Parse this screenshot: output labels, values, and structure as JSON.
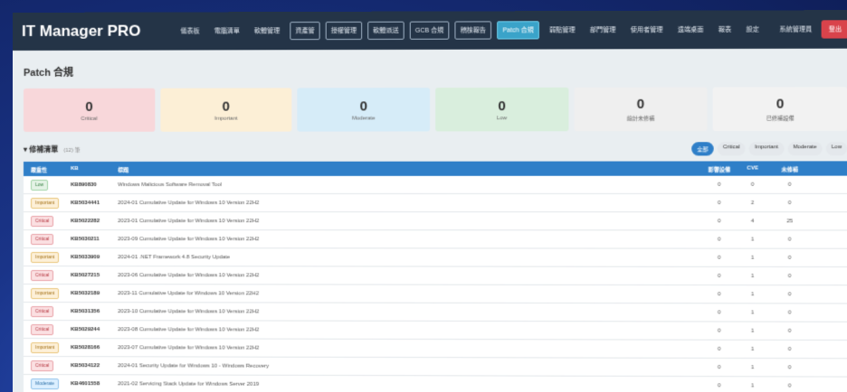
{
  "app": {
    "title": "IT Manager PRO",
    "user": "系統管理員",
    "logout": "登出"
  },
  "nav": [
    {
      "label": "儀表板",
      "style": "plain"
    },
    {
      "label": "電腦清單",
      "style": "plain"
    },
    {
      "label": "軟體管理",
      "style": "plain"
    },
    {
      "label": "資產管",
      "style": "boxed"
    },
    {
      "label": "授權管理",
      "style": "boxed"
    },
    {
      "label": "軟體派送",
      "style": "boxed"
    },
    {
      "label": "GCB 合規",
      "style": "boxed"
    },
    {
      "label": "稽核報告",
      "style": "boxed"
    },
    {
      "label": "Patch 合規",
      "style": "active"
    },
    {
      "label": "弱點管理",
      "style": "plain"
    },
    {
      "label": "部門管理",
      "style": "plain"
    },
    {
      "label": "使用者管理",
      "style": "plain"
    },
    {
      "label": "遠端桌面",
      "style": "plain"
    },
    {
      "label": "報表",
      "style": "plain"
    },
    {
      "label": "設定",
      "style": "plain"
    }
  ],
  "page": {
    "title": "Patch 合規"
  },
  "stats": [
    {
      "value": "0",
      "label": "Critical",
      "tone": "critical"
    },
    {
      "value": "0",
      "label": "Important",
      "tone": "important"
    },
    {
      "value": "0",
      "label": "Moderate",
      "tone": "moderate"
    },
    {
      "value": "0",
      "label": "Low",
      "tone": "low"
    },
    {
      "value": "0",
      "label": "總計未修補",
      "tone": "gray1"
    },
    {
      "value": "0",
      "label": "已修補設備",
      "tone": "gray2"
    }
  ],
  "list": {
    "title": "▾ 修補清單",
    "count": "(12) 筆",
    "filters": [
      {
        "label": "全部",
        "active": true
      },
      {
        "label": "Critical",
        "active": false
      },
      {
        "label": "Important",
        "active": false
      },
      {
        "label": "Moderate",
        "active": false
      },
      {
        "label": "Low",
        "active": false
      }
    ],
    "columns": [
      "嚴重性",
      "KB",
      "標題",
      "影響設備",
      "CVE",
      "未修補"
    ],
    "rows": [
      {
        "sev": "Low",
        "tone": "low",
        "kb": "KB890830",
        "title": "Windows Malicious Software Removal Tool",
        "a": "0",
        "b": "0",
        "c": "0"
      },
      {
        "sev": "Important",
        "tone": "important",
        "kb": "KB5034441",
        "title": "2024-01 Cumulative Update for Windows 10 Version 22H2",
        "a": "0",
        "b": "2",
        "c": "0"
      },
      {
        "sev": "Critical",
        "tone": "critical",
        "kb": "KB5022282",
        "title": "2023-01 Cumulative Update for Windows 10 Version 22H2",
        "a": "0",
        "b": "4",
        "c": "25"
      },
      {
        "sev": "Critical",
        "tone": "critical",
        "kb": "KB5030211",
        "title": "2023-09 Cumulative Update for Windows 10 Version 22H2",
        "a": "0",
        "b": "1",
        "c": "0"
      },
      {
        "sev": "Important",
        "tone": "important",
        "kb": "KB5033909",
        "title": "2024-01 .NET Framework 4.8 Security Update",
        "a": "0",
        "b": "1",
        "c": "0"
      },
      {
        "sev": "Critical",
        "tone": "critical",
        "kb": "KB5027215",
        "title": "2023-06 Cumulative Update for Windows 10 Version 22H2",
        "a": "0",
        "b": "1",
        "c": "0"
      },
      {
        "sev": "Important",
        "tone": "important",
        "kb": "KB5032189",
        "title": "2023-11 Cumulative Update for Windows 10 Version 22H2",
        "a": "0",
        "b": "1",
        "c": "0"
      },
      {
        "sev": "Critical",
        "tone": "critical",
        "kb": "KB5031356",
        "title": "2023-10 Cumulative Update for Windows 10 Version 22H2",
        "a": "0",
        "b": "1",
        "c": "0"
      },
      {
        "sev": "Critical",
        "tone": "critical",
        "kb": "KB5029244",
        "title": "2023-08 Cumulative Update for Windows 10 Version 22H2",
        "a": "0",
        "b": "1",
        "c": "0"
      },
      {
        "sev": "Important",
        "tone": "important",
        "kb": "KB5028166",
        "title": "2023-07 Cumulative Update for Windows 10 Version 22H2",
        "a": "0",
        "b": "1",
        "c": "0"
      },
      {
        "sev": "Critical",
        "tone": "critical",
        "kb": "KB5034122",
        "title": "2024-01 Security Update for Windows 10 - Windows Recovery",
        "a": "0",
        "b": "1",
        "c": "0"
      },
      {
        "sev": "Moderate",
        "tone": "moderate",
        "kb": "KB4601558",
        "title": "2021-02 Servicing Stack Update for Windows Server 2019",
        "a": "0",
        "b": "1",
        "c": "0"
      }
    ]
  },
  "colors": {
    "topbar": "#243447",
    "accent": "#2f7fc8",
    "active_nav": "#3aa3c9",
    "logout": "#d9434b"
  }
}
